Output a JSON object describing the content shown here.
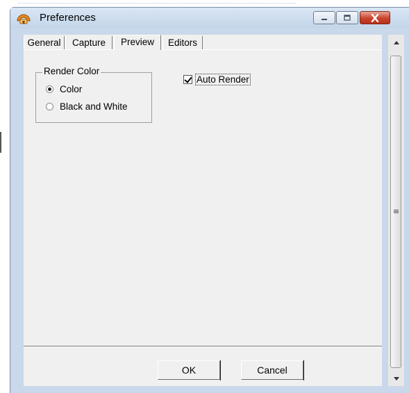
{
  "window": {
    "title": "Preferences",
    "controls": {
      "minimize": "minimize",
      "maximize": "maximize",
      "close": "close"
    }
  },
  "tabs": [
    {
      "label": "General",
      "active": false
    },
    {
      "label": "Capture",
      "active": false
    },
    {
      "label": "Preview",
      "active": true
    },
    {
      "label": "Editors",
      "active": false
    }
  ],
  "render_color": {
    "legend": "Render Color",
    "options": [
      {
        "label": "Color",
        "selected": true
      },
      {
        "label": "Black and White",
        "selected": false
      }
    ]
  },
  "auto_render": {
    "label": "Auto Render",
    "checked": true
  },
  "buttons": {
    "ok": "OK",
    "cancel": "Cancel"
  },
  "icons": {
    "app": "preferences-app-icon",
    "minimize": "minimize-icon",
    "maximize": "maximize-icon",
    "close": "close-icon",
    "scroll_up": "scroll-up-arrow-icon",
    "scroll_down": "scroll-down-arrow-icon"
  },
  "colors": {
    "titlebar": "#c9d8ea",
    "close_button": "#c9442c",
    "dialog_bg": "#f0f0f0"
  }
}
